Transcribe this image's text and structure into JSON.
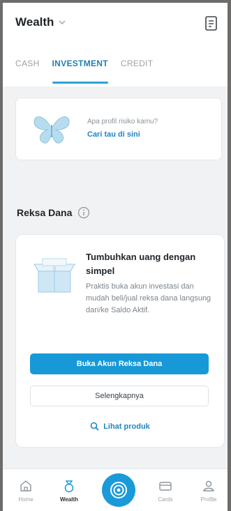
{
  "header": {
    "title": "Wealth"
  },
  "tabs": [
    {
      "label": "CASH",
      "active": false
    },
    {
      "label": "INVESTMENT",
      "active": true
    },
    {
      "label": "CREDIT",
      "active": false
    }
  ],
  "risk_card": {
    "question": "Apa profil risiko kamu?",
    "link": "Cari tau di sini"
  },
  "section": {
    "title": "Reksa Dana"
  },
  "reksa_dana_card": {
    "headline": "Tumbuhkan uang dengan simpel",
    "description": "Praktis buka akun investasi dan mudah beli/jual reksa dana langsung dari/ke Saldo Aktif.",
    "primary_button": "Buka Akun Reksa Dana",
    "secondary_button": "Selengkapnya",
    "product_link": "Lihat produk"
  },
  "bottom_nav": {
    "items": [
      {
        "label": "Home",
        "icon": "home-icon",
        "active": false
      },
      {
        "label": "Wealth",
        "icon": "wealth-icon",
        "active": true
      },
      {
        "label": "",
        "icon": "center-action-icon",
        "active": false
      },
      {
        "label": "Cards",
        "icon": "card-icon",
        "active": false
      },
      {
        "label": "Profile",
        "icon": "profile-icon",
        "active": false
      }
    ]
  },
  "colors": {
    "accent": "#1799d8",
    "link": "#1f85c4",
    "text_dark": "#1f2428",
    "text_muted": "#7b858d"
  }
}
